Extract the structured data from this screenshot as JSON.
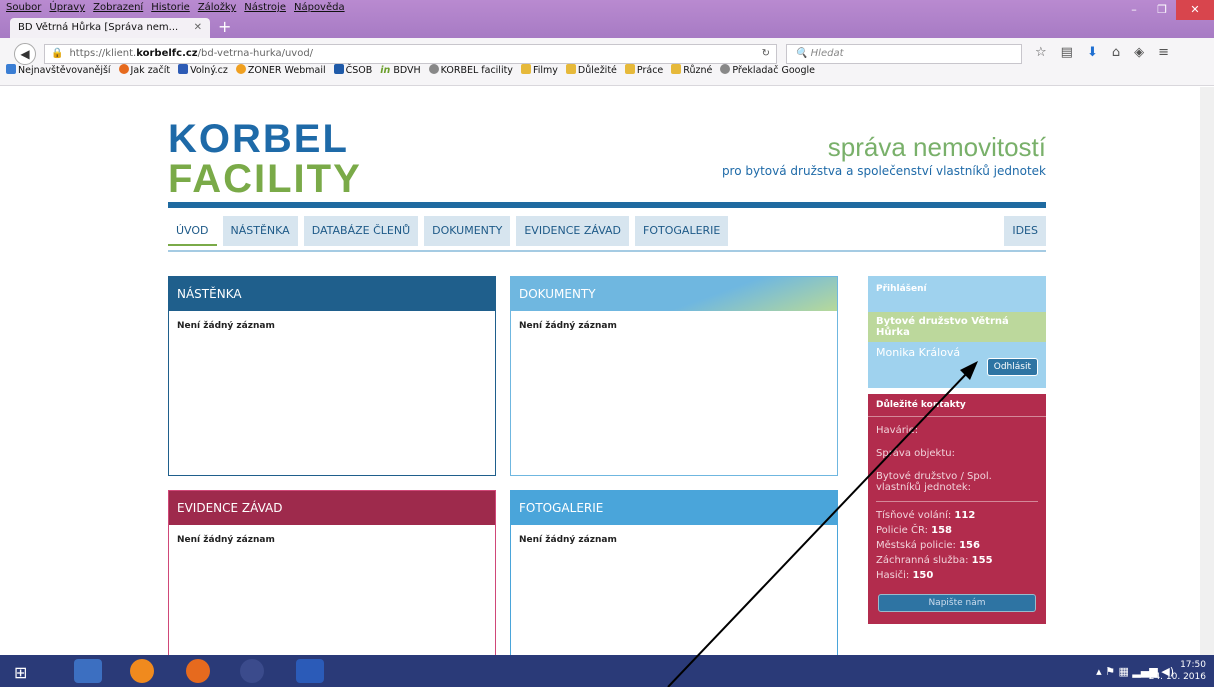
{
  "browser": {
    "menu": [
      "Soubor",
      "Úpravy",
      "Zobrazení",
      "Historie",
      "Záložky",
      "Nástroje",
      "Nápověda"
    ],
    "tab_title": "BD Větrná Hůrka [Správa nem...",
    "url_prefix": "https://klient.",
    "url_domain": "korbelfc.cz",
    "url_path": "/bd-vetrna-hurka/uvod/",
    "search_placeholder": "Hledat",
    "bookmarks": [
      "Nejnavštěvovanější",
      "Jak začít",
      "Volný.cz",
      "ZONER Webmail",
      "ČSOB",
      "in",
      "BDVH",
      "KORBEL facility",
      "Filmy",
      "Důležité",
      "Práce",
      "Různé",
      "Překladač Google"
    ]
  },
  "header": {
    "logo_line1": "KORBEL",
    "logo_line2": "FACILITY",
    "tagline": "správa nemovitostí",
    "subtagline": "pro bytová družstva a společenství vlastníků jednotek"
  },
  "menu": [
    "ÚVOD",
    "NÁSTĚNKA",
    "DATABÁZE ČLENŮ",
    "DOKUMENTY",
    "EVIDENCE ZÁVAD",
    "FOTOGALERIE"
  ],
  "menu_right": "IDES",
  "panels": {
    "nastenka": {
      "title": "NÁSTĚNKA",
      "empty": "Není žádný záznam"
    },
    "dokumenty": {
      "title": "DOKUMENTY",
      "empty": "Není žádný záznam"
    },
    "evidence": {
      "title": "EVIDENCE ZÁVAD",
      "empty": "Není žádný záznam"
    },
    "fotogalerie": {
      "title": "FOTOGALERIE",
      "empty": "Není žádný záznam"
    }
  },
  "login": {
    "title": "Přihlášení",
    "org": "Bytové družstvo Větrná Hůrka",
    "user": "Monika Králová",
    "logout": "Odhlásit"
  },
  "contacts": {
    "title": "Důležité kontakty",
    "havarie": "Havárie:",
    "sprava": "Správa objektu:",
    "druzstvo": "Bytové družstvo / Spol. vlastníků jednotek:",
    "tisnove_label": "Tísňové volání:",
    "tisnove": "112",
    "policie_label": "Policie ČR:",
    "policie": "158",
    "mestska_label": "Městská policie:",
    "mestska": "156",
    "zachranna_label": "Záchranná služba:",
    "zachranna": "155",
    "hasici_label": "Hasiči:",
    "hasici": "150",
    "write": "Napište nám"
  },
  "taskbar": {
    "time": "17:50",
    "date": "24. 10. 2016"
  },
  "colors": {
    "brand_blue": "#1e6aa8",
    "brand_green": "#7aaa48",
    "nastenka": "#1f5f8c",
    "dokumenty": "#6fb7e0",
    "evidence": "#9e2a4c",
    "fotogalerie": "#4aa5da",
    "contacts_bg": "#b22c4d"
  }
}
